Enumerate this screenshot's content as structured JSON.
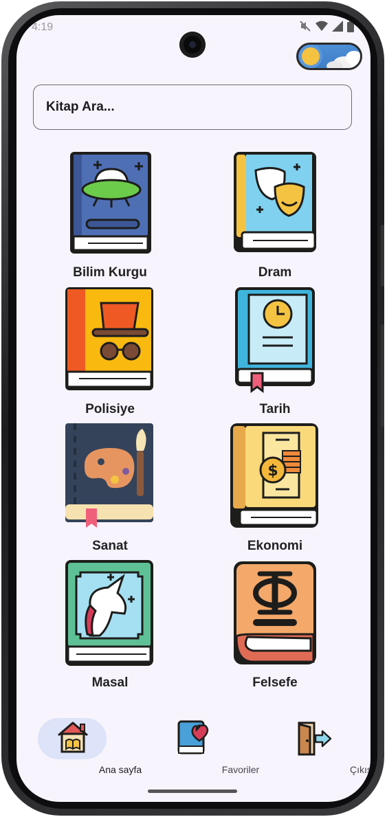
{
  "status_bar": {
    "time": "4:19"
  },
  "search": {
    "placeholder": "Kitap Ara..."
  },
  "categories": [
    {
      "label": "Bilim Kurgu",
      "icon": "ufo-book-icon"
    },
    {
      "label": "Dram",
      "icon": "theater-masks-book-icon"
    },
    {
      "label": "Polisiye",
      "icon": "detective-book-icon"
    },
    {
      "label": "Tarih",
      "icon": "clock-book-icon"
    },
    {
      "label": "Sanat",
      "icon": "palette-book-icon"
    },
    {
      "label": "Ekonomi",
      "icon": "coins-book-icon"
    },
    {
      "label": "Masal",
      "icon": "unicorn-book-icon"
    },
    {
      "label": "Felsefe",
      "icon": "phi-book-icon"
    }
  ],
  "bottom_nav": {
    "items": [
      {
        "label": "Ana sayfa",
        "icon": "home-book-icon",
        "selected": true
      },
      {
        "label": "Favoriler",
        "icon": "heart-book-icon",
        "selected": false
      },
      {
        "label": "Çıkış",
        "icon": "exit-door-icon",
        "selected": false
      }
    ]
  },
  "colors": {
    "background": "#f7f4fd",
    "selected_pill": "#dde3f8",
    "text": "#222222"
  }
}
